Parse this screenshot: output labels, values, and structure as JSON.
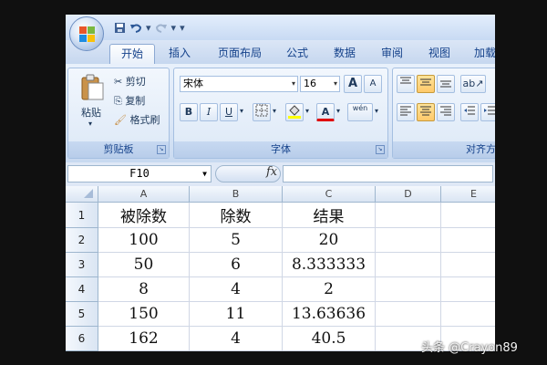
{
  "qat": {
    "save_icon": "save-icon",
    "undo_icon": "undo-icon",
    "redo_icon": "redo-icon",
    "customize": "▾"
  },
  "tabs": [
    "开始",
    "插入",
    "页面布局",
    "公式",
    "数据",
    "审阅",
    "视图",
    "加载"
  ],
  "ribbon": {
    "clipboard": {
      "paste": "粘贴",
      "cut": "剪切",
      "copy": "复制",
      "format_painter": "格式刷",
      "label": "剪贴板"
    },
    "font": {
      "font_name": "宋体",
      "font_size": "16",
      "grow": "A",
      "shrink": "A",
      "bold": "B",
      "italic": "I",
      "underline": "U",
      "font_color": "A",
      "phonetic": "wén",
      "label": "字体"
    },
    "alignment": {
      "label": "对齐方"
    }
  },
  "formula_bar": {
    "name_box": "F10",
    "fx": "fx",
    "formula": ""
  },
  "columns": [
    "A",
    "B",
    "C",
    "D",
    "E"
  ],
  "rows": [
    {
      "num": "1",
      "cells": [
        "被除数",
        "除数",
        "结果",
        "",
        ""
      ]
    },
    {
      "num": "2",
      "cells": [
        "100",
        "5",
        "20",
        "",
        ""
      ]
    },
    {
      "num": "3",
      "cells": [
        "50",
        "6",
        "8.333333",
        "",
        ""
      ]
    },
    {
      "num": "4",
      "cells": [
        "8",
        "4",
        "2",
        "",
        ""
      ]
    },
    {
      "num": "5",
      "cells": [
        "150",
        "11",
        "13.63636",
        "",
        ""
      ]
    },
    {
      "num": "6",
      "cells": [
        "162",
        "4",
        "40.5",
        "",
        ""
      ]
    }
  ],
  "watermark": "头条 @Crayon89",
  "colors": {
    "accent": "#15428b",
    "ribbon": "#dbe7f7",
    "highlight": "#ffc96a"
  }
}
